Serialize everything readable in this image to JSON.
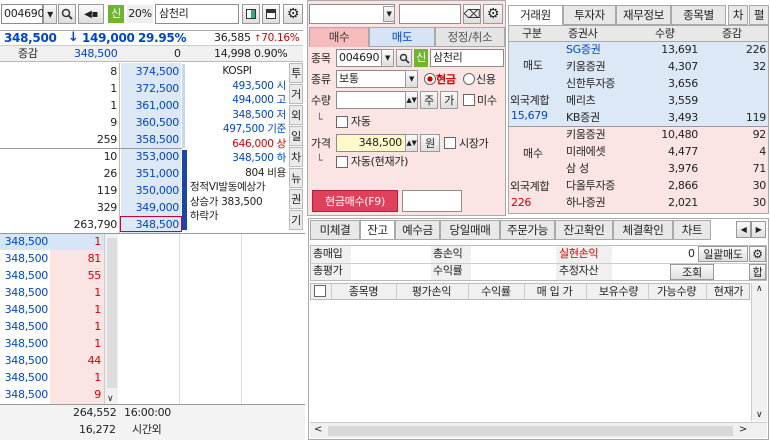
{
  "left": {
    "code": "004690",
    "badge": "신",
    "pct": "20%",
    "name": "삼천리",
    "price": "348,500",
    "change": "149,000",
    "rate": "29.95%",
    "volume": "36,585",
    "vol_rate": "70.16%",
    "sub_label": "증감",
    "sub_price": "348,500",
    "sub_zero": "0",
    "sub_vol": "14,998",
    "sub_pct": "0.90%",
    "ask": [
      {
        "qty": "8",
        "price": "374,500"
      },
      {
        "qty": "1",
        "price": "372,500"
      },
      {
        "qty": "1",
        "price": "361,000"
      },
      {
        "qty": "9",
        "price": "360,500"
      },
      {
        "qty": "259",
        "price": "358,500"
      },
      {
        "qty": "10",
        "price": "353,000"
      },
      {
        "qty": "26",
        "price": "351,000"
      },
      {
        "qty": "119",
        "price": "350,000"
      },
      {
        "qty": "329",
        "price": "349,000"
      },
      {
        "qty": "263,790",
        "price": "348,500"
      }
    ],
    "info": [
      {
        "text": "KOSPI"
      },
      {
        "text": "493,500 시"
      },
      {
        "text": "494,000 고"
      },
      {
        "text": "348,500 저"
      },
      {
        "text": "497,500 기준"
      },
      {
        "text": "646,000 상"
      },
      {
        "text": "348,500 하"
      },
      {
        "text": "804 비용"
      },
      {
        "text": "정적VI발동예상가"
      },
      {
        "text": "상승가  383,500"
      },
      {
        "text": "하락가"
      }
    ],
    "side_tabs": [
      "투",
      "거",
      "외",
      "일",
      "차",
      "뉴",
      "권",
      "기"
    ],
    "trades": [
      {
        "price": "348,500",
        "qty": "1"
      },
      {
        "price": "348,500",
        "qty": "81"
      },
      {
        "price": "348,500",
        "qty": "55"
      },
      {
        "price": "348,500",
        "qty": "1"
      },
      {
        "price": "348,500",
        "qty": "1"
      },
      {
        "price": "348,500",
        "qty": "1"
      },
      {
        "price": "348,500",
        "qty": "1"
      },
      {
        "price": "348,500",
        "qty": "44"
      },
      {
        "price": "348,500",
        "qty": "1"
      },
      {
        "price": "348,500",
        "qty": "9"
      }
    ],
    "bottom_total1": "264,552",
    "bottom_time": "16:00:00",
    "bottom_total2": "16,272",
    "bottom_label": "시간외"
  },
  "order": {
    "tabs": [
      "매수",
      "매도",
      "정정/취소"
    ],
    "code_label": "종목",
    "code": "004690",
    "badge": "신",
    "name": "삼천리",
    "type_label": "종류",
    "type_value": "보통",
    "cash_label": "현금",
    "credit_label": "신용",
    "qty_label": "수량",
    "qty_unit": "주",
    "qty_btn": "가",
    "unfilled_label": "미수",
    "auto_label": "자동",
    "price_label": "가격",
    "price_value": "348,500",
    "price_unit": "원",
    "market_label": "시장가",
    "auto2_label": "자동(현재가)",
    "submit_label": "현금매수(F9)"
  },
  "broker": {
    "tabs": [
      "거래원",
      "투자자",
      "재무정보",
      "종목별",
      "차",
      "펼"
    ],
    "headers": [
      "구분",
      "증권사",
      "수량",
      "증감"
    ],
    "sell_label": "매도",
    "sell_rows": [
      {
        "name": "SG증권",
        "qty": "13,691",
        "chg": "226"
      },
      {
        "name": "키움증권",
        "qty": "4,307",
        "chg": "32"
      },
      {
        "name": "신한투자증",
        "qty": "3,656",
        "chg": ""
      },
      {
        "name": "메리츠",
        "qty": "3,559",
        "chg": ""
      },
      {
        "name": "KB증권",
        "qty": "3,493",
        "chg": "119"
      }
    ],
    "sell_foreign_label": "외국계합",
    "sell_foreign_value": "15,679",
    "buy_label": "매수",
    "buy_rows": [
      {
        "name": "키움증권",
        "qty": "10,480",
        "chg": "92"
      },
      {
        "name": "미래에셋",
        "qty": "4,477",
        "chg": "4"
      },
      {
        "name": "삼 성",
        "qty": "3,976",
        "chg": "71"
      },
      {
        "name": "다올투자증",
        "qty": "2,866",
        "chg": "30"
      },
      {
        "name": "하나증권",
        "qty": "2,021",
        "chg": "30"
      }
    ],
    "buy_foreign_label": "외국계합",
    "buy_foreign_value": "226"
  },
  "balance": {
    "tabs": [
      "미체결",
      "잔고",
      "예수금",
      "당일매매",
      "주문가능",
      "잔고확인",
      "체결확인",
      "차트"
    ],
    "total_buy_label": "총매입",
    "total_pl_label": "총손익",
    "realized_label": "실현손익",
    "realized_value": "0",
    "bulk_sell_label": "일괄매도",
    "total_eval_label": "총평가",
    "return_label": "수익률",
    "est_asset_label": "추정자산",
    "query_label": "조회",
    "next_label": "합",
    "columns": [
      "종목명",
      "평가손익",
      "수익률",
      "매 입 가",
      "보유수량",
      "가능수량",
      "현재가"
    ]
  },
  "colors": {
    "ask_bg": "#dde8f7",
    "bid_bg": "#fbe4e4",
    "accent_red": "#d40000",
    "accent_blue": "#0046c8"
  }
}
